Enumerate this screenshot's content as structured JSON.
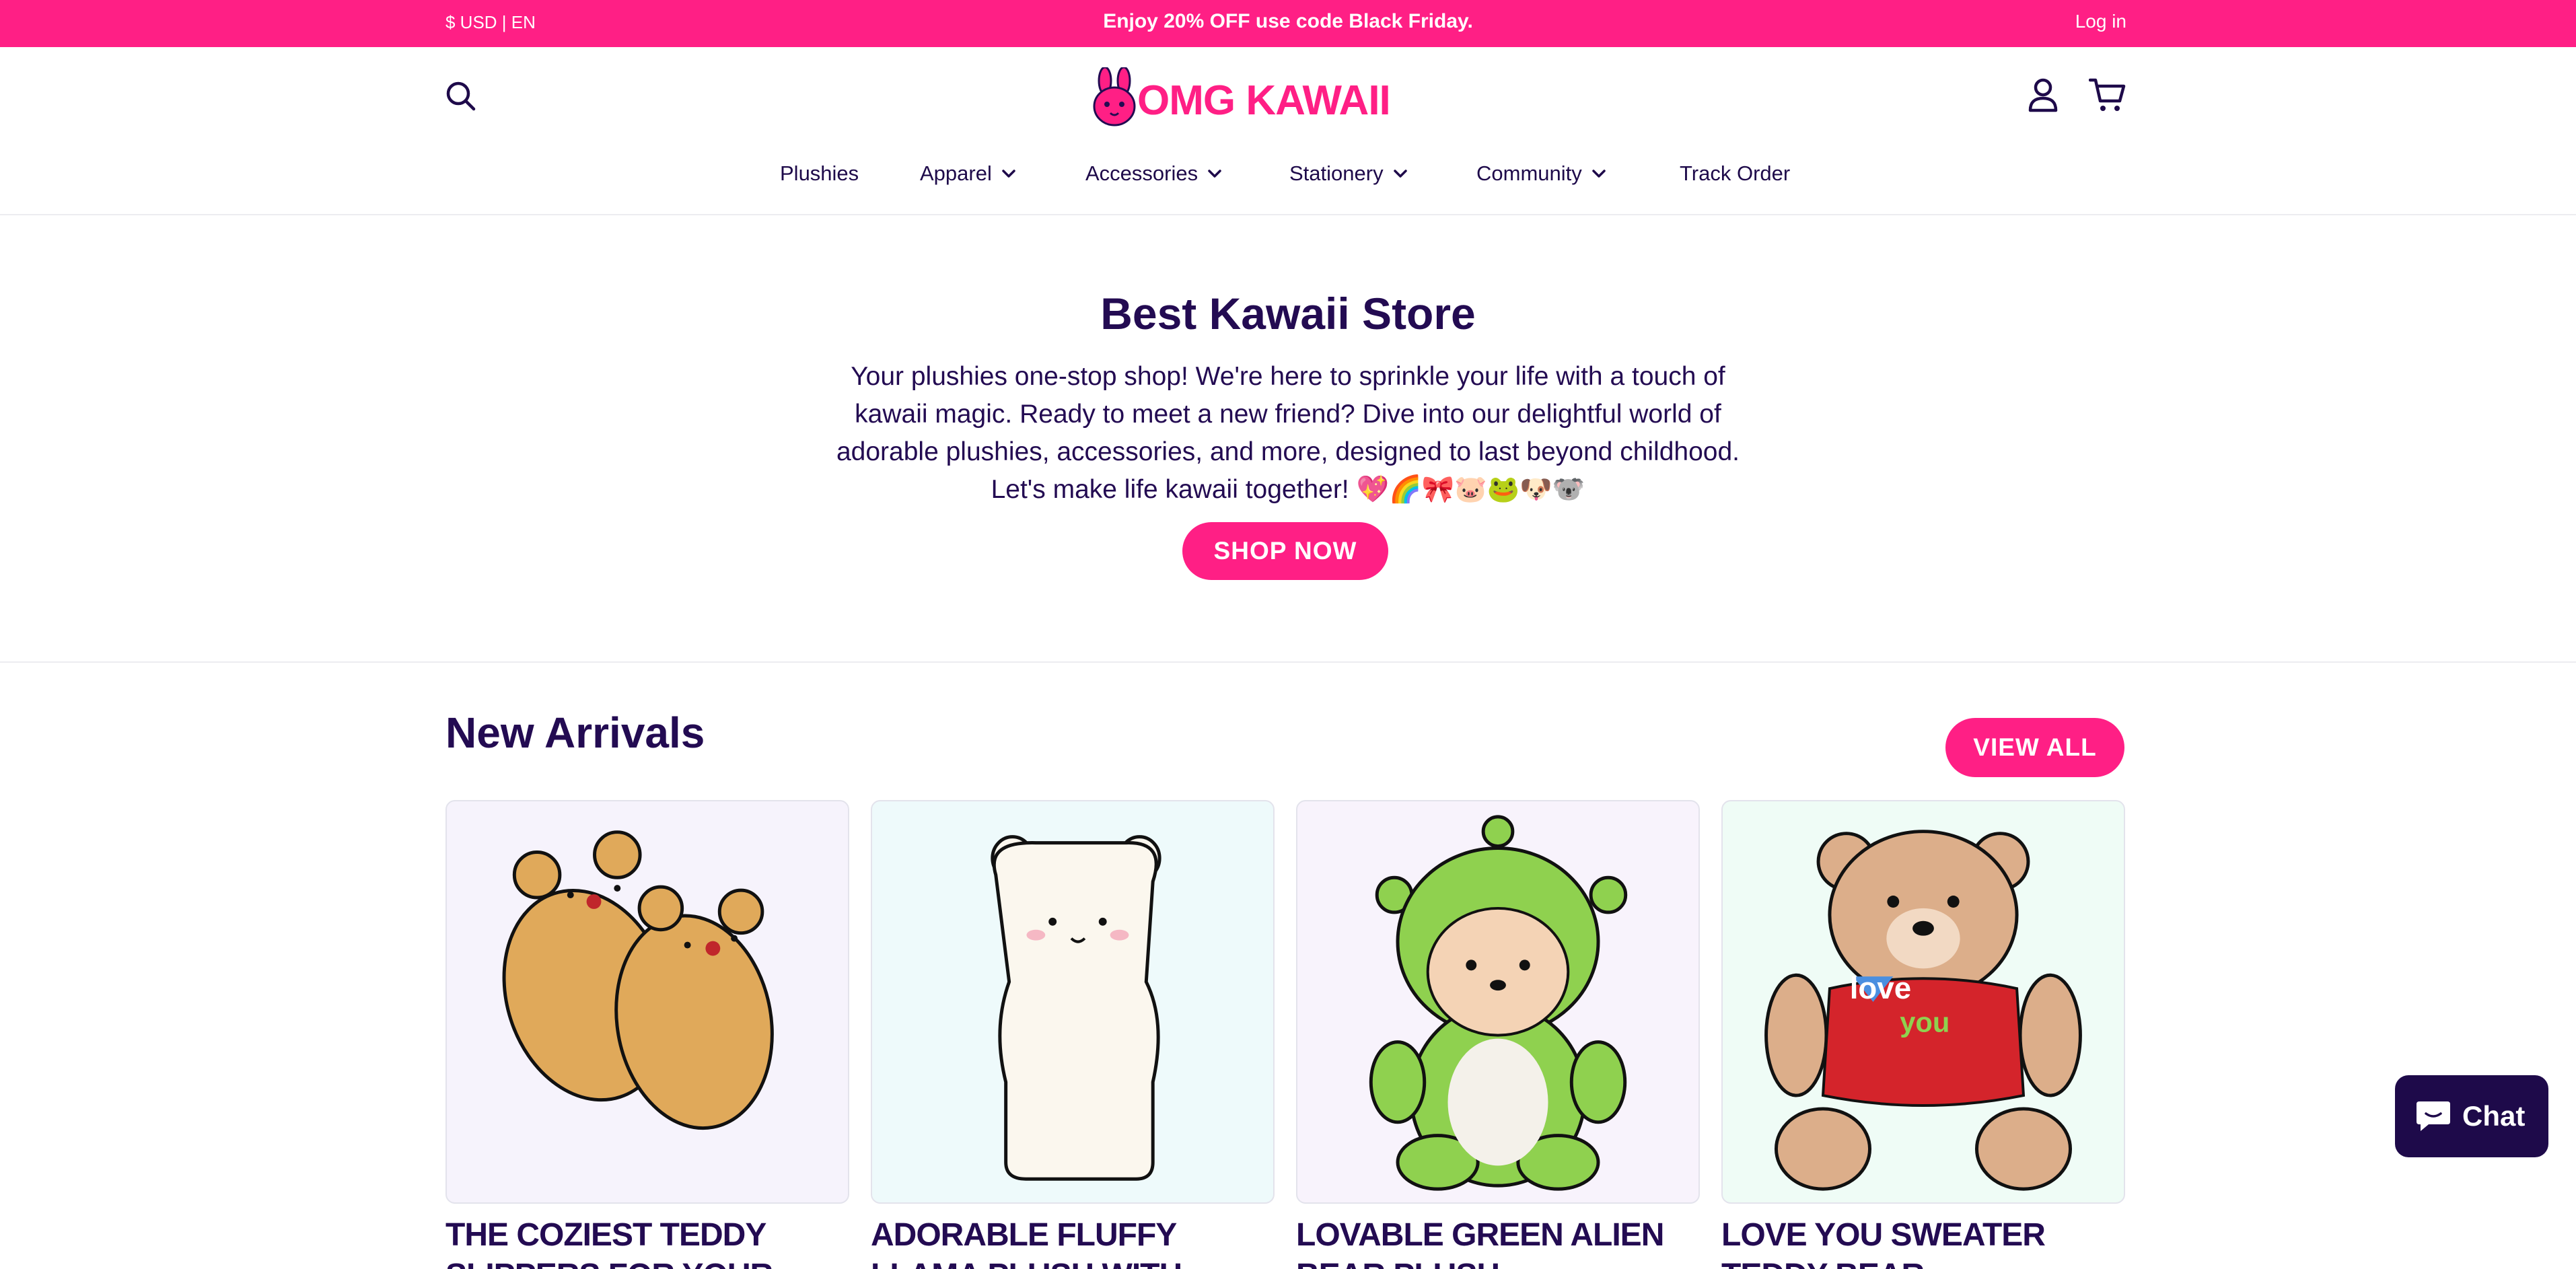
{
  "announcement": {
    "currency_lang": "$ USD | EN",
    "promo": "Enjoy 20% OFF use code Black Friday.",
    "login": "Log in"
  },
  "header": {
    "logo_text": "OMG KAWAII",
    "nav": [
      {
        "label": "Plushies",
        "dropdown": false
      },
      {
        "label": "Apparel",
        "dropdown": true
      },
      {
        "label": "Accessories",
        "dropdown": true
      },
      {
        "label": "Stationery",
        "dropdown": true
      },
      {
        "label": "Community",
        "dropdown": true
      },
      {
        "label": "Track Order",
        "dropdown": false
      }
    ]
  },
  "hero": {
    "title": "Best Kawaii Store",
    "line1": "Your plushies one-stop shop! We're here to sprinkle your life with a touch of",
    "line2": "kawaii magic. Ready to meet a new friend? Dive into our delightful world of",
    "line3": "adorable plushies, accessories, and more, designed to last beyond childhood.",
    "line4": "Let's make life kawaii together! 💖🌈🎀🐷🐸🐶🐨",
    "cta": "SHOP NOW"
  },
  "new_arrivals": {
    "title": "New Arrivals",
    "view_all": "VIEW ALL",
    "products": [
      {
        "title_line1": "THE COZIEST TEDDY",
        "title_line2": "SLIPPERS FOR YOUR",
        "bg": "#f6f3fc"
      },
      {
        "title_line1": "ADORABLE FLUFFY",
        "title_line2": "LLAMA PLUSH WITH",
        "bg": "#eefafb"
      },
      {
        "title_line1": "LOVABLE GREEN ALIEN",
        "title_line2": "BEAR PLUSH",
        "bg": "#f8f3fc"
      },
      {
        "title_line1": "LOVE YOU SWEATER",
        "title_line2": "TEDDY BEAR",
        "bg": "#effcf6"
      }
    ]
  },
  "chat": {
    "label": "Chat"
  },
  "colors": {
    "brand_pink": "#ff1f85",
    "navy": "#1e0a4a"
  }
}
